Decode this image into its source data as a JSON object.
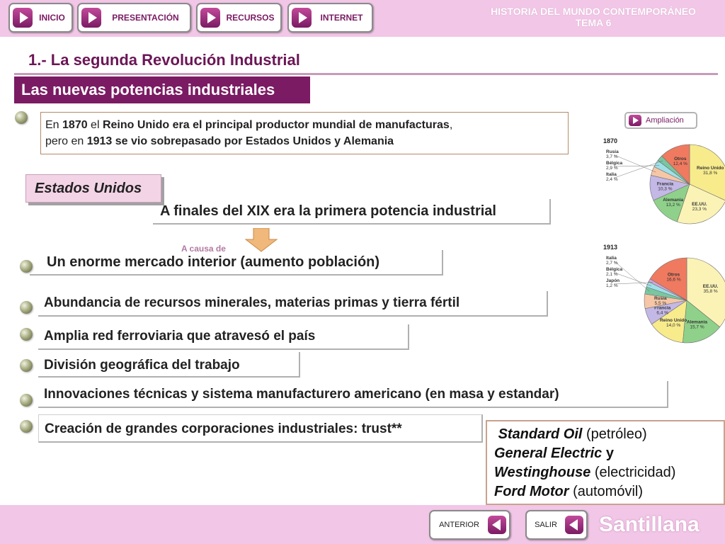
{
  "nav": {
    "buttons": [
      "INICIO",
      "PRESENTACIÓN",
      "RECURSOS",
      "INTERNET"
    ]
  },
  "header": {
    "subject": "HISTORIA DEL MUNDO CONTEMPORÁNEO",
    "unit": "TEMA 6"
  },
  "section": {
    "title": "1.- La segunda Revolución Industrial",
    "subtitle": "Las nuevas potencias industriales"
  },
  "intro": {
    "p1": "En ",
    "y1": "1870",
    "p2": " el ",
    "b1": "Reino Unido era el principal productor mundial de manufacturas",
    "p3": ",",
    "p4": "pero en ",
    "y2": "1913",
    "b2": " se vio sobrepasado por Estados Unidos y Alemania"
  },
  "ampliacion": "Ampliación",
  "country_badge": "Estados Unidos",
  "statement": "A finales del XIX era la primera potencia industrial",
  "cause_label": "A causa de",
  "causes": [
    "Un enorme mercado interior (aumento población)",
    "Abundancia de recursos minerales, materias primas y tierra fértil",
    "Amplia red ferroviaria que atravesó el país",
    "División geográfica del trabajo",
    "Innovaciones técnicas y sistema manufacturero americano (en masa y estandar)",
    "Creación de grandes corporaciones industriales: trust**"
  ],
  "companies": {
    "c1": "Standard Oil",
    "d1": " (petróleo)",
    "c2": "General Electric",
    "j": "  y",
    "c3": "Westinghouse",
    "d3": " (electricidad)",
    "c4": "Ford Motor",
    "d4": " (automóvil)"
  },
  "footer": {
    "prev": "ANTERIOR",
    "exit": "SALIR",
    "brand": "Santillana"
  },
  "colors": {
    "brand_purple": "#7a1b63",
    "bar_pink": "#f2c6e7"
  },
  "chart_data": [
    {
      "type": "pie",
      "title": "1870",
      "categories": [
        "Reino Unido",
        "EE.UU.",
        "Alemania",
        "Francia",
        "Rusia",
        "Bélgica",
        "Italia",
        "Otros"
      ],
      "values": [
        31.8,
        23.3,
        13.2,
        10.3,
        3.7,
        2.9,
        2.4,
        12.4
      ],
      "labels": [
        "31,8 %",
        "23,3 %",
        "13,2 %",
        "10,3 %",
        "3,7 %",
        "2,9 %",
        "2,4 %",
        "12,4 %"
      ],
      "colors": [
        "#f7eb8c",
        "#fbf3b6",
        "#8fd18a",
        "#c3b8e6",
        "#f6c7a6",
        "#9fe0e8",
        "#79c6a0",
        "#ef7a60"
      ]
    },
    {
      "type": "pie",
      "title": "1913",
      "categories": [
        "EE.UU.",
        "Alemania",
        "Reino Unido",
        "Francia",
        "Rusia",
        "Italia",
        "Bélgica",
        "Japón",
        "Otros"
      ],
      "values": [
        35.8,
        15.7,
        14.0,
        6.4,
        5.5,
        2.7,
        2.1,
        1.2,
        16.6
      ],
      "labels": [
        "35,8 %",
        "15,7 %",
        "14,0 %",
        "6,4 %",
        "5,5 %",
        "2,7 %",
        "2,1 %",
        "1,2 %",
        "16,6 %"
      ],
      "colors": [
        "#fbf3b6",
        "#8fd18a",
        "#f7eb8c",
        "#c3b8e6",
        "#f6c7a6",
        "#79c6a0",
        "#9fe0e8",
        "#d4a6d8",
        "#ef7a60"
      ]
    }
  ]
}
